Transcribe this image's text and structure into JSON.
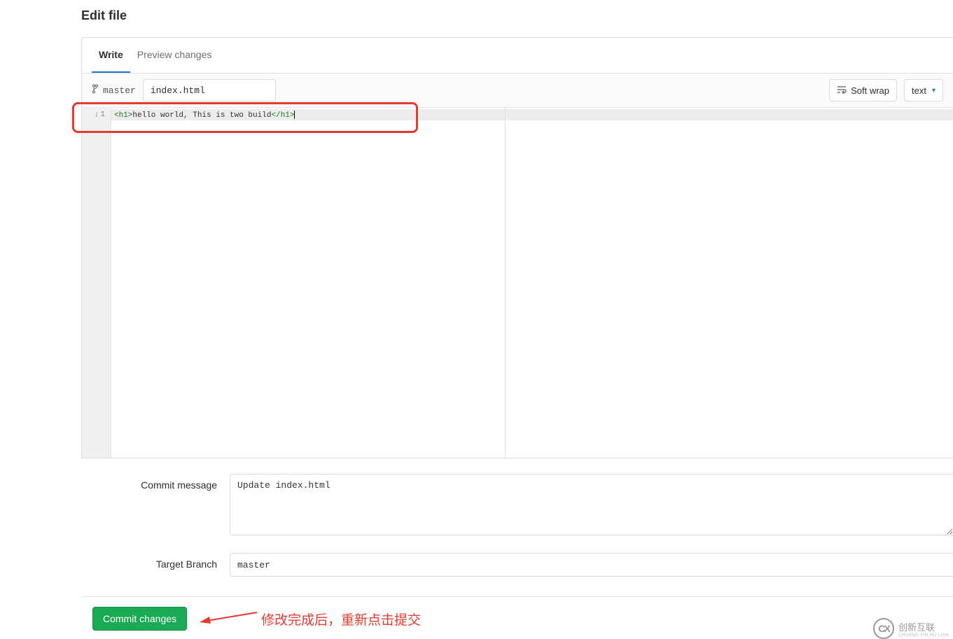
{
  "page": {
    "title": "Edit file"
  },
  "tabs": {
    "write": "Write",
    "preview": "Preview changes"
  },
  "toolbar": {
    "branch_name": "master",
    "filename": "index.html",
    "softwrap_label": "Soft wrap",
    "mode_label": "text"
  },
  "editor": {
    "line_number": "1",
    "code_tag_open": "<h1>",
    "code_text": "hello world, This is two build",
    "code_tag_close": "</h1>"
  },
  "form": {
    "commit_label": "Commit message",
    "commit_value": "Update index.html",
    "target_label": "Target Branch",
    "target_value": "master"
  },
  "actions": {
    "commit_button": "Commit changes"
  },
  "annotation": {
    "text": "修改完成后，重新点击提交"
  },
  "watermark": {
    "brand": "创新互联",
    "sub": "CHUANG XIN HU LIAN"
  }
}
